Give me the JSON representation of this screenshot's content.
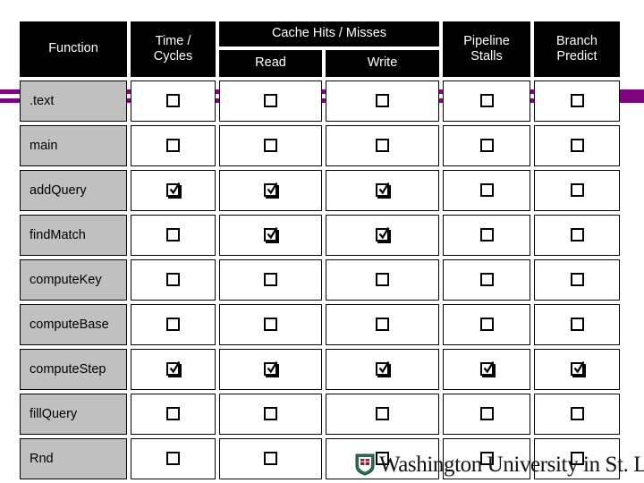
{
  "table": {
    "headers": {
      "function": "Function",
      "time_cycles": "Time /\nCycles",
      "time_line1": "Time /",
      "time_line2": "Cycles",
      "cache_group": "Cache Hits / Misses",
      "read": "Read",
      "write": "Write",
      "pipeline_line1": "Pipeline",
      "pipeline_line2": "Stalls",
      "branch_line1": "Branch",
      "branch_line2": "Predict"
    },
    "columns": [
      "Function",
      "Time / Cycles",
      "Read",
      "Write",
      "Pipeline Stalls",
      "Branch Predict"
    ],
    "rows": [
      {
        "function": ".text",
        "time": false,
        "read": false,
        "write": false,
        "stalls": false,
        "branch": false
      },
      {
        "function": "main",
        "time": false,
        "read": false,
        "write": false,
        "stalls": false,
        "branch": false
      },
      {
        "function": "addQuery",
        "time": true,
        "read": true,
        "write": true,
        "stalls": false,
        "branch": false
      },
      {
        "function": "findMatch",
        "time": false,
        "read": true,
        "write": true,
        "stalls": false,
        "branch": false
      },
      {
        "function": "computeKey",
        "time": false,
        "read": false,
        "write": false,
        "stalls": false,
        "branch": false
      },
      {
        "function": "computeBase",
        "time": false,
        "read": false,
        "write": false,
        "stalls": false,
        "branch": false
      },
      {
        "function": "computeStep",
        "time": true,
        "read": true,
        "write": true,
        "stalls": true,
        "branch": true
      },
      {
        "function": "fillQuery",
        "time": false,
        "read": false,
        "write": false,
        "stalls": false,
        "branch": false
      },
      {
        "function": "Rnd",
        "time": false,
        "read": false,
        "write": false,
        "stalls": false,
        "branch": false
      }
    ]
  },
  "brand": {
    "name": "Washington University in St. Louis",
    "crest_icon": "shield-crest-icon"
  },
  "colors": {
    "accent_purple": "#7d057d",
    "header_bg": "#000000",
    "header_text": "#ffffff",
    "label_bg": "#c0c0c0",
    "cell_bg": "#ffffff",
    "border": "#000000"
  }
}
